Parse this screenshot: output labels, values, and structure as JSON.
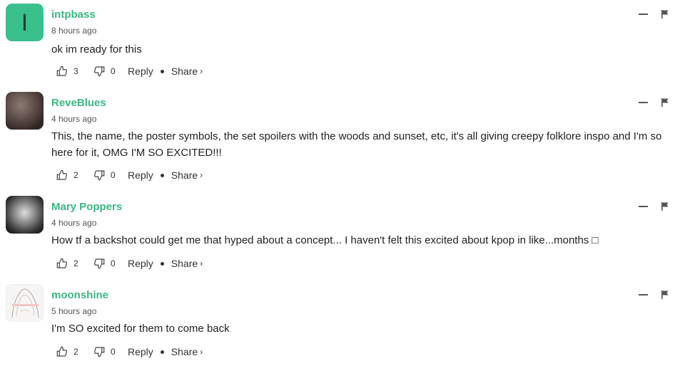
{
  "comments": [
    {
      "username": "intpbass",
      "timestamp": "8 hours ago",
      "avatar_letter": "I",
      "text": "ok im ready for this",
      "likes": "3",
      "dislikes": "0",
      "reply_label": "Reply",
      "share_label": "Share",
      "share_chevron": "›"
    },
    {
      "username": "ReveBlues",
      "timestamp": "4 hours ago",
      "text": "This, the name, the poster symbols, the set spoilers with the woods and sunset, etc, it's all giving creepy folklore inspo and I'm so here for it, OMG I'M SO EXCITED!!!",
      "likes": "2",
      "dislikes": "0",
      "reply_label": "Reply",
      "share_label": "Share",
      "share_chevron": "›"
    },
    {
      "username": "Mary Poppers",
      "timestamp": "4 hours ago",
      "text": "How tf a backshot could get me that hyped about a concept... I haven't felt this excited about kpop in like...months □",
      "likes": "2",
      "dislikes": "0",
      "reply_label": "Reply",
      "share_label": "Share",
      "share_chevron": "›"
    },
    {
      "username": "moonshine",
      "timestamp": "5 hours ago",
      "text": "I'm SO excited for them to come back",
      "likes": "2",
      "dislikes": "0",
      "reply_label": "Reply",
      "share_label": "Share",
      "share_chevron": "›"
    }
  ],
  "colors": {
    "username": "#3ab884",
    "avatar_letter_bg": "#3ac08c"
  },
  "icons": {
    "like": "thumbs-up-icon",
    "dislike": "thumbs-down-icon",
    "minimize": "minimize-icon",
    "flag": "flag-icon"
  }
}
